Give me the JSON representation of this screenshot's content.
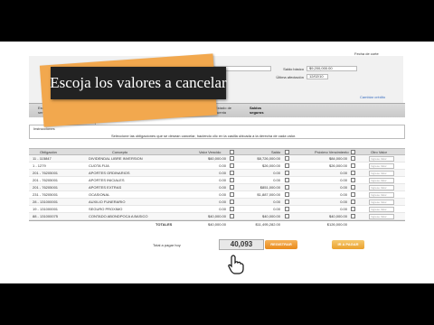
{
  "header": {
    "fecha_corte_label": "Fecha de corte",
    "saldo_basico_label": "Saldo básico",
    "saldo_basico_value": "$9,200,000.00",
    "ultima_afectacion_label": "Última afectación",
    "ultima_afectacion_value": "12/02/10"
  },
  "caption": "Escoja los valores a cancelar",
  "cambiar_link": "Cambiar crédito",
  "tabs": [
    "Estado de créditos/ servicios",
    "Deudas por créditos/ servicios",
    "Movimientos de créditos/ servicios",
    "Movimientos de financiación",
    "Pagos",
    "Estado de cuenta",
    "Saldos seguros"
  ],
  "subtabs": [
    "Pagos",
    "Recibos"
  ],
  "instructions": {
    "title": "Instrucciones",
    "text": "Seleccione las obligaciones que se desean cancelar, haciendo clic en la casilla ubicada a la derecha de cada valor."
  },
  "table": {
    "columns": [
      "Obligación",
      "Concepto",
      "Valor Vencido",
      "Saldo",
      "Próximo Vencimiento",
      "Otro Valor"
    ],
    "rows": [
      {
        "obligacion": "11 - 115847",
        "concepto": "DIVIDENDAL LIBRE INVERSION",
        "vencido": "$60,000.00",
        "saldo": "$8,726,000.00",
        "proximo": "$84,000.00"
      },
      {
        "obligacion": "1 - 1279",
        "concepto": "CUOTA FIJA",
        "vencido": "0.00",
        "saldo": "$26,000.00",
        "proximo": "$26,000.00"
      },
      {
        "obligacion": "201 - 76205001",
        "concepto": "APORTES ORDINARIOS",
        "vencido": "0.00",
        "saldo": "0.00",
        "proximo": "0.00"
      },
      {
        "obligacion": "201 - 76205001",
        "concepto": "APORTES INICIALES",
        "vencido": "0.00",
        "saldo": "0.00",
        "proximo": "0.00"
      },
      {
        "obligacion": "201 - 76205001",
        "concepto": "APORTES EXTRAS",
        "vencido": "0.00",
        "saldo": "$851,000.00",
        "proximo": "0.00"
      },
      {
        "obligacion": "231 - 76205001",
        "concepto": "OCASIONAL",
        "vencido": "0.00",
        "saldo": "$1,887,000.00",
        "proximo": "0.00"
      },
      {
        "obligacion": "28 - 131000001",
        "concepto": "AUXILIO FUNERARIO",
        "vencido": "0.00",
        "saldo": "0.00",
        "proximo": "0.00"
      },
      {
        "obligacion": "19 - 131000001",
        "concepto": "SEGURO PROXIMO",
        "vencido": "0.00",
        "saldo": "0.00",
        "proximo": "0.00"
      },
      {
        "obligacion": "88 - 131000075",
        "concepto": "CONTADO ABONDPOCA A BASICO",
        "vencido": "$40,000.00",
        "saldo": "$40,000.00",
        "proximo": "$40,000.00"
      }
    ],
    "otro_valor_placeholder": "Ingrese Valor",
    "totales_label": "TOTALES",
    "totales": {
      "vencido": "$40,000.00",
      "saldo": "$11,495,282.00",
      "proximo": "$126,000.00"
    }
  },
  "footer": {
    "total_label": "Total a pagar hoy",
    "total_value": "40,093",
    "btn_registrar": "REGISTRAR",
    "btn_ir_a_pagar": "IR A PAGAR"
  }
}
